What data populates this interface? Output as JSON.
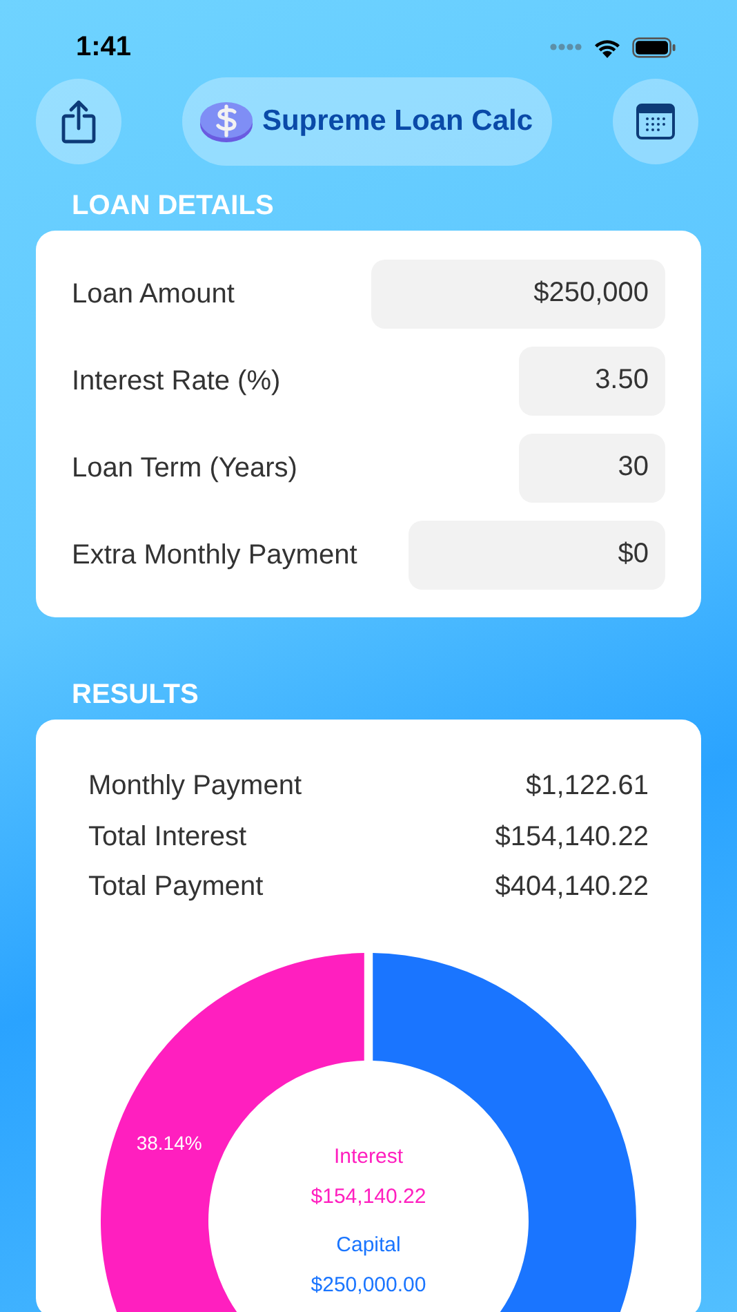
{
  "status_bar": {
    "time": "1:41"
  },
  "header": {
    "title": "Supreme Loan Calc"
  },
  "loan_details": {
    "heading": "LOAN DETAILS",
    "fields": [
      {
        "label": "Loan Amount",
        "value": "$250,000",
        "kind": "wide"
      },
      {
        "label": "Interest Rate (%)",
        "value": "3.50",
        "kind": "narrow"
      },
      {
        "label": "Loan Term (Years)",
        "value": "30",
        "kind": "narrow"
      },
      {
        "label": "Extra Monthly Payment",
        "value": "$0",
        "kind": "medium"
      }
    ]
  },
  "results": {
    "heading": "RESULTS",
    "rows": [
      {
        "label": "Monthly Payment",
        "value": "$1,122.61"
      },
      {
        "label": "Total Interest",
        "value": "$154,140.22"
      },
      {
        "label": "Total Payment",
        "value": "$404,140.22"
      }
    ],
    "chart_data": {
      "type": "donut",
      "categories": [
        "Interest",
        "Capital"
      ],
      "values": [
        38.14,
        61.86
      ],
      "value_labels": [
        "38.14%",
        null
      ]
    },
    "center_legend": [
      {
        "value": "$154,140.22",
        "color": "#ff1fbf"
      },
      {
        "value": "$250,000.00",
        "color": "#1a75ff"
      }
    ]
  }
}
